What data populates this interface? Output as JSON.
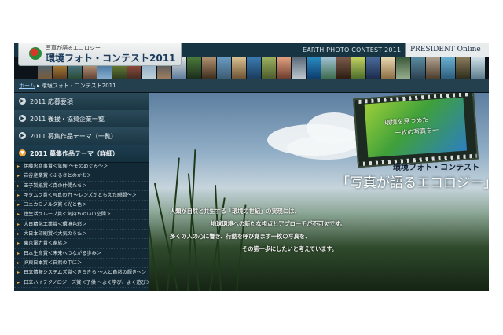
{
  "header": {
    "logo_subtitle": "写真が語るエコロジー",
    "logo_title": "環境フォト・コンテスト2011",
    "contest_title": "EARTH PHOTO CONTEST 2011",
    "president_label": "PRESIDENT Online"
  },
  "breadcrumb": {
    "home": "ホーム",
    "separator": " ▸ ",
    "current": "環境フォト・コンテスト2011"
  },
  "sidebar": {
    "items": [
      {
        "label": "2011 応募要項"
      },
      {
        "label": "2011 後援・協賛企業一覧"
      },
      {
        "label": "2011 募集作品テーマ（一覧）"
      },
      {
        "label": "2011 募集作品テーマ（詳細）"
      }
    ],
    "sub_items": [
      "伊藤忠商事賞＜気候 ～そのめぐみ～＞",
      "岩谷産業賞＜ふるさとのかお＞",
      "王子製紙賞＜森の仲間たち＞",
      "キタムラ賞＜写真の力 ～レンズがとらえた瞬間～＞",
      "コニカミノルタ賞＜光と色＞",
      "住生活グループ賞＜気持ちのいい空間＞",
      "大日精化工業賞＜環境色彩＞",
      "大日本印刷賞＜大気のうた＞",
      "東京電力賞＜家族＞",
      "日本生命賞＜未来へつながる歩み＞",
      "JR東日本賞＜自然の中に＞",
      "日立情報システムズ賞＜きらきら ～人と自然の輝き～＞",
      "日立ハイテクノロジーズ賞＜子供 ～よく学び、よく遊び＞"
    ]
  },
  "hero": {
    "film_line1": "環境を見つめた",
    "film_line2": "一枚の写真を一",
    "title_small": "環境フォト・コンテスト",
    "title_large": "「写真が語るエコロジー」",
    "lines": [
      "人類が自然と共生する「環境の世紀」の実現には、",
      "地球環境への新たな視点とアプローチが不可欠です。",
      "多くの人の心に響き、行動を呼び覚ます一枚の写真を、",
      "その第一歩にしたいと考えています。"
    ]
  },
  "colors": {
    "page_bg": "#0b1a22",
    "header_bg": "#163442",
    "sidebar_bg": "#132a36",
    "accent_orange": "#f2a73b",
    "link_blue": "#9fd3ff"
  }
}
